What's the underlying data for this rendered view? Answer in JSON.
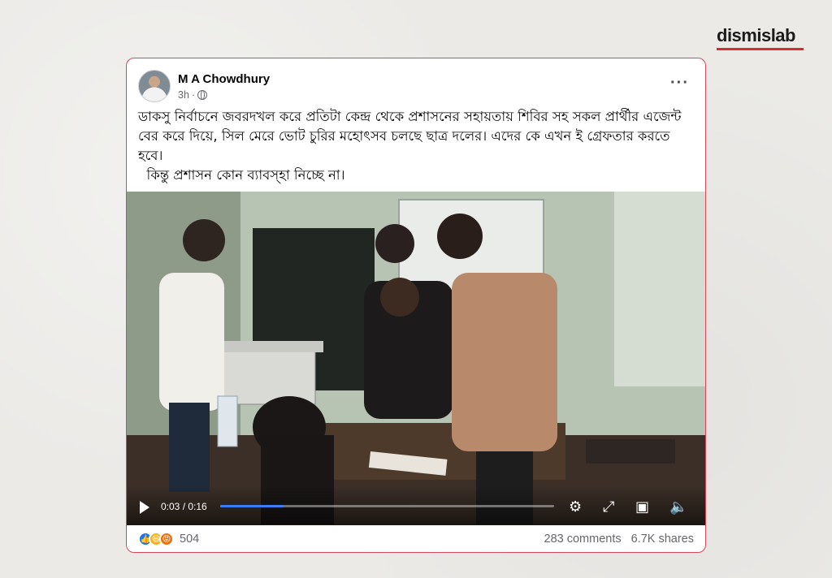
{
  "brand": {
    "name": "dismislab",
    "accent": "#d32f2f"
  },
  "post": {
    "author": "M A Chowdhury",
    "time": "3h",
    "visibility_separator": "·",
    "privacy_icon": "globe-icon",
    "more_icon": "more-options-icon",
    "text_line1": "ডাকসু নির্বাচনে জবরদখল করে প্রতিটা কেন্দ্র থেকে প্রশাসনের সহায়তায় শিবির সহ সকল প্রার্থীর এজেন্ট বের করে দিয়ে, সিল মেরে ভোট চুরির মহোৎসব চলছে ছাত্র দলের। এদের কে এখন ই গ্রেফতার করতে হবে।",
    "text_line2": "  কিন্তু প্রশাসন কোন ব্যাবস্হা নিচ্ছে না।"
  },
  "video": {
    "time_display": "0:03 / 0:16",
    "progress_fraction": 0.19,
    "progress_color": "#3a7df7",
    "controls": [
      "play-icon",
      "settings-icon",
      "fullscreen-icon",
      "pip-icon",
      "volume-icon"
    ]
  },
  "footer": {
    "reaction_count": "504",
    "reactions": [
      "like",
      "haha",
      "angry"
    ],
    "comments": "283 comments",
    "shares": "6.7K shares"
  }
}
